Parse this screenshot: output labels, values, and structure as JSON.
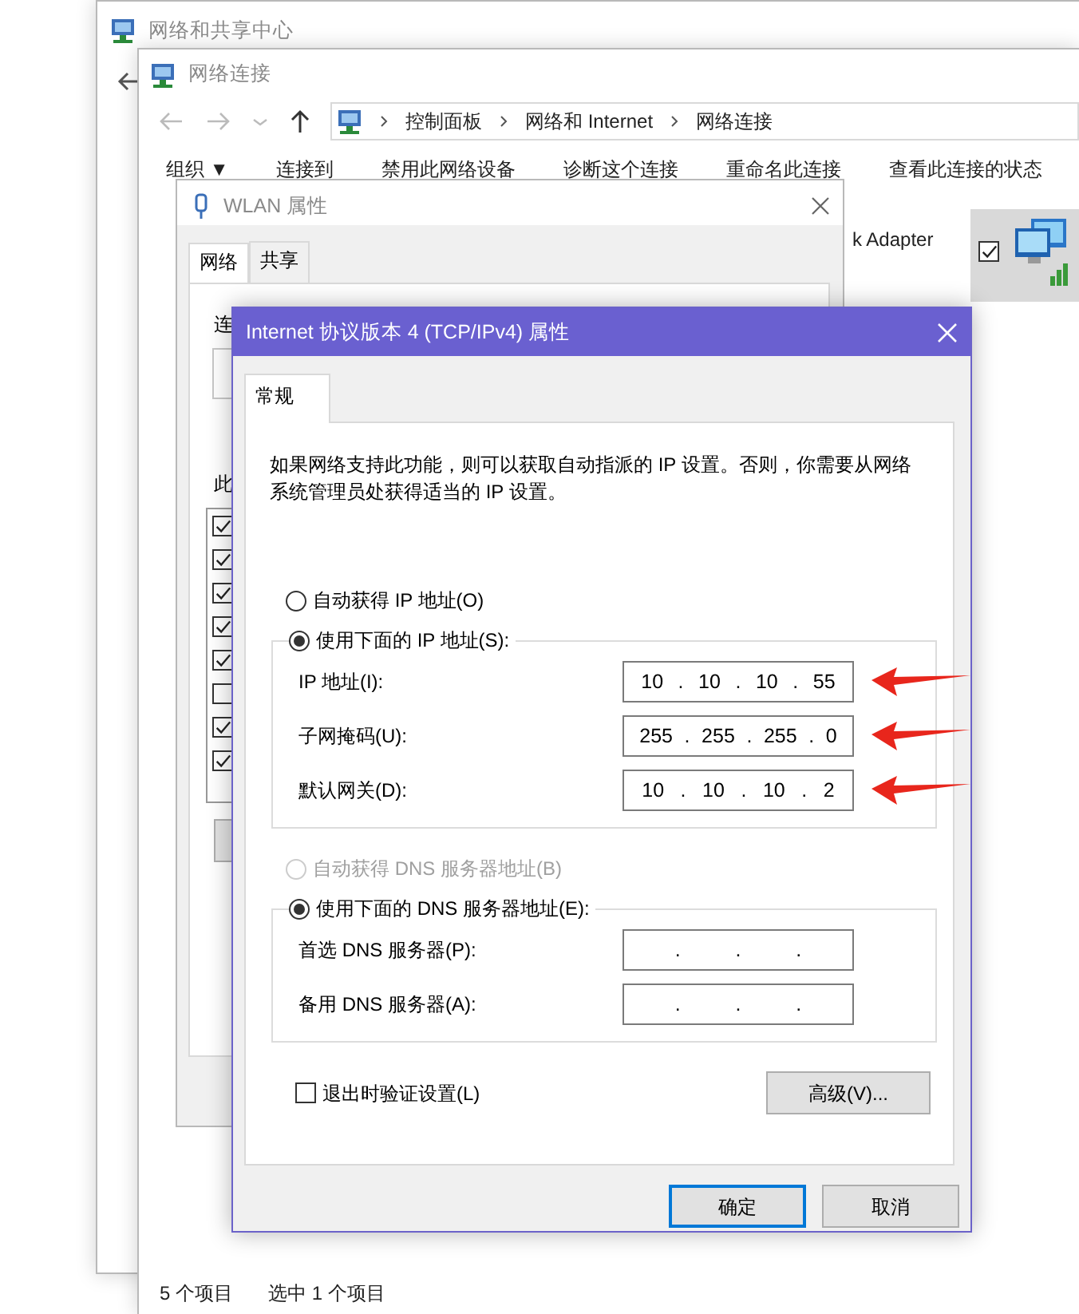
{
  "sharing_center": {
    "title": "网络和共享中心"
  },
  "connections_window": {
    "title": "网络连接",
    "breadcrumb": [
      "控制面板",
      "网络和 Internet",
      "网络连接"
    ],
    "toolbar": [
      "组织 ▼",
      "连接到",
      "禁用此网络设备",
      "诊断这个连接",
      "重命名此连接",
      "查看此连接的状态"
    ],
    "adapter": {
      "label": "k Adapter",
      "checked": true,
      "selected": true
    },
    "status_bar": [
      "5 个项目",
      "选中 1 个项目"
    ]
  },
  "wlan_window": {
    "title": "WLAN 属性",
    "tabs": [
      {
        "label": "网络",
        "selected": true
      },
      {
        "label": "共享",
        "selected": false
      }
    ],
    "fragments": [
      "连",
      "此"
    ],
    "components": [
      {
        "checked": true
      },
      {
        "checked": true
      },
      {
        "checked": true
      },
      {
        "checked": true
      },
      {
        "checked": true
      },
      {
        "checked": false
      },
      {
        "checked": true
      },
      {
        "checked": true
      }
    ]
  },
  "ipv4_dialog": {
    "title": "Internet 协议版本 4 (TCP/IPv4) 属性",
    "tabs": [
      {
        "label": "常规",
        "selected": true
      }
    ],
    "description": "如果网络支持此功能，则可以获取自动指派的 IP 设置。否则，你需要从网络系统管理员处获得适当的 IP 设置。",
    "octet_separator": ".",
    "ip_modes": [
      {
        "label": "自动获得 IP 地址(O)",
        "selected": false,
        "disabled": false
      },
      {
        "label": "使用下面的 IP 地址(S):",
        "selected": true,
        "disabled": false
      }
    ],
    "ip_fields": [
      {
        "label": "IP 地址(I):",
        "octets": [
          "10",
          "10",
          "10",
          "55"
        ]
      },
      {
        "label": "子网掩码(U):",
        "octets": [
          "255",
          "255",
          "255",
          "0"
        ]
      },
      {
        "label": "默认网关(D):",
        "octets": [
          "10",
          "10",
          "10",
          "2"
        ]
      }
    ],
    "dns_modes": [
      {
        "label": "自动获得 DNS 服务器地址(B)",
        "selected": false,
        "disabled": true
      },
      {
        "label": "使用下面的 DNS 服务器地址(E):",
        "selected": true,
        "disabled": false
      }
    ],
    "dns_fields": [
      {
        "label": "首选 DNS 服务器(P):"
      },
      {
        "label": "备用 DNS 服务器(A):"
      }
    ],
    "validate_on_exit": {
      "label": "退出时验证设置(L)",
      "checked": false
    },
    "advanced_button": "高级(V)...",
    "buttons": [
      {
        "label": "确定",
        "default": true
      },
      {
        "label": "取消",
        "default": false
      }
    ]
  }
}
